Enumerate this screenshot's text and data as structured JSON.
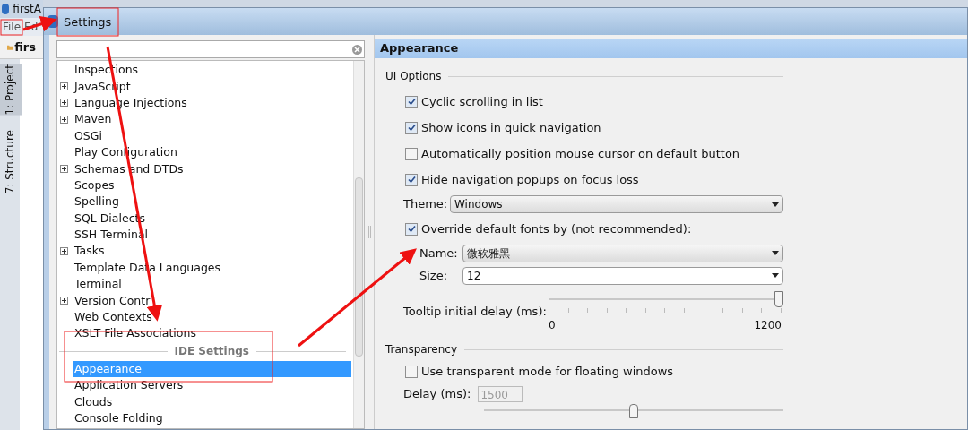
{
  "ide": {
    "title": "firstA",
    "menu": [
      "File",
      "Ed"
    ],
    "toolbar_label": "firs",
    "tool_tabs": [
      "1: Project",
      "7: Structure"
    ]
  },
  "dialog": {
    "title": "Settings",
    "tree": [
      {
        "kind": "item",
        "label": "Inspections",
        "expandable": false,
        "selected": false
      },
      {
        "kind": "item",
        "label": "JavaScript",
        "expandable": true,
        "selected": false
      },
      {
        "kind": "item",
        "label": "Language Injections",
        "expandable": true,
        "selected": false
      },
      {
        "kind": "item",
        "label": "Maven",
        "expandable": true,
        "selected": false
      },
      {
        "kind": "item",
        "label": "OSGi",
        "expandable": false,
        "selected": false
      },
      {
        "kind": "item",
        "label": "Play Configuration",
        "expandable": false,
        "selected": false
      },
      {
        "kind": "item",
        "label": "Schemas and DTDs",
        "expandable": true,
        "selected": false
      },
      {
        "kind": "item",
        "label": "Scopes",
        "expandable": false,
        "selected": false
      },
      {
        "kind": "item",
        "label": "Spelling",
        "expandable": false,
        "selected": false
      },
      {
        "kind": "item",
        "label": "SQL Dialects",
        "expandable": false,
        "selected": false
      },
      {
        "kind": "item",
        "label": "SSH Terminal",
        "expandable": false,
        "selected": false
      },
      {
        "kind": "item",
        "label": "Tasks",
        "expandable": true,
        "selected": false
      },
      {
        "kind": "item",
        "label": "Template Data Languages",
        "expandable": false,
        "selected": false
      },
      {
        "kind": "item",
        "label": "Terminal",
        "expandable": false,
        "selected": false
      },
      {
        "kind": "item",
        "label": "Version Contr",
        "expandable": true,
        "selected": false
      },
      {
        "kind": "item",
        "label": "Web Contexts",
        "expandable": false,
        "selected": false
      },
      {
        "kind": "item",
        "label": "XSLT File Associations",
        "expandable": false,
        "selected": false
      },
      {
        "kind": "header",
        "label": "IDE Settings"
      },
      {
        "kind": "item",
        "label": "Appearance",
        "expandable": false,
        "selected": true
      },
      {
        "kind": "item",
        "label": "Application Servers",
        "expandable": false,
        "selected": false
      },
      {
        "kind": "item",
        "label": "Clouds",
        "expandable": false,
        "selected": false
      },
      {
        "kind": "item",
        "label": "Console Folding",
        "expandable": false,
        "selected": false
      }
    ],
    "page_title": "Appearance",
    "ui_options": {
      "title": "UI Options",
      "rows": [
        {
          "kind": "checkbox",
          "label": "Cyclic scrolling in list",
          "checked": true
        },
        {
          "kind": "checkbox",
          "label": "Show icons in quick navigation",
          "checked": true
        },
        {
          "kind": "checkbox",
          "label": "Automatically position mouse cursor on default button",
          "checked": false
        },
        {
          "kind": "checkbox",
          "label": "Hide navigation popups on focus loss",
          "checked": true
        },
        {
          "kind": "combo",
          "label": "Theme:",
          "value": "Windows"
        },
        {
          "kind": "checkbox",
          "label": "Override default fonts by (not recommended):",
          "checked": true
        },
        {
          "kind": "subcombo",
          "label": "Name:",
          "value": "微软雅黑"
        },
        {
          "kind": "subcombo",
          "label": "Size:",
          "value": "12"
        },
        {
          "kind": "slider",
          "label": "Tooltip initial delay (ms):",
          "level": 1,
          "min": "0",
          "max": "1200"
        }
      ]
    },
    "transparency": {
      "title": "Transparency",
      "use_transparent": {
        "label": "Use transparent mode for floating windows",
        "checked": false
      },
      "delay": {
        "label": "Delay (ms):",
        "value": "1500",
        "disabled": true
      },
      "ratio_slider": {
        "level": 0.5
      }
    }
  }
}
